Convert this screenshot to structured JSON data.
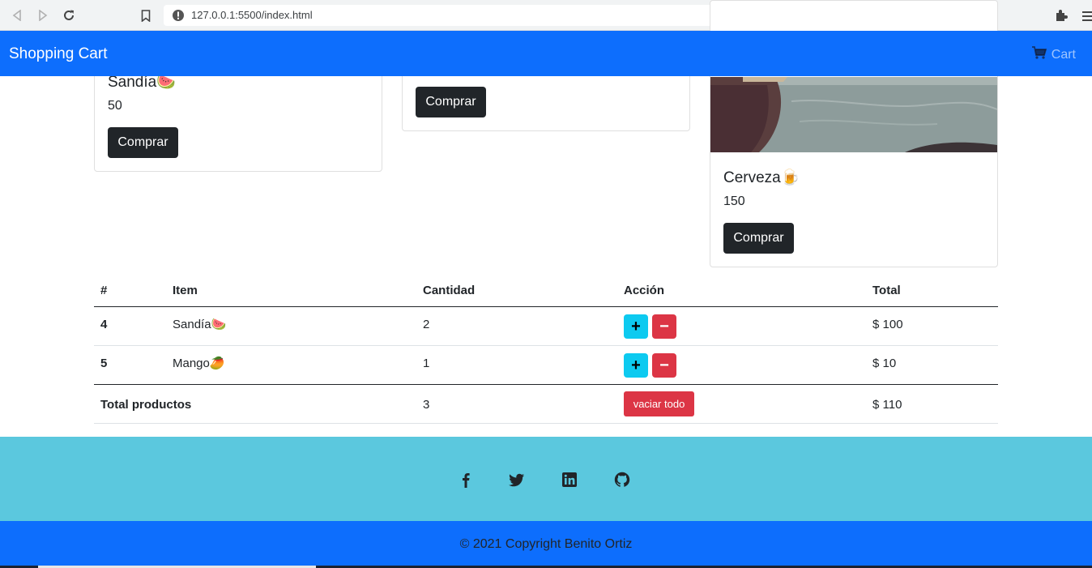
{
  "browser": {
    "url": "127.0.0.1:5500/index.html"
  },
  "navbar": {
    "brand": "Shopping Cart",
    "cart_label": "Cart"
  },
  "products": [
    {
      "name": "Sandía",
      "emoji": "🍉",
      "price": "50",
      "button": "Comprar"
    },
    {
      "button": "Comprar"
    },
    {
      "name": "Cerveza",
      "emoji": "🍺",
      "price": "150",
      "button": "Comprar"
    }
  ],
  "cart_table": {
    "headers": [
      "#",
      "Item",
      "Cantidad",
      "Acción",
      "Total"
    ],
    "rows": [
      {
        "id": "4",
        "item": "Sandía",
        "emoji": "🍉",
        "qty": "2",
        "total": "$ 100",
        "plus": "+",
        "minus": "−"
      },
      {
        "id": "5",
        "item": "Mango",
        "emoji": "🥭",
        "qty": "1",
        "total": "$ 10",
        "plus": "+",
        "minus": "−"
      }
    ],
    "footer": {
      "label": "Total productos",
      "qty": "3",
      "empty_button": "vaciar todo",
      "total": "$ 110"
    }
  },
  "footer": {
    "social_icons": [
      "facebook-icon",
      "twitter-icon",
      "linkedin-icon",
      "github-icon"
    ],
    "copyright": "© 2021 Copyright Benito Ortiz"
  },
  "colors": {
    "primary": "#0d6efd",
    "info": "#0dcaf0",
    "danger": "#dc3545",
    "dark": "#212529",
    "footer_top": "#5bc8de"
  }
}
